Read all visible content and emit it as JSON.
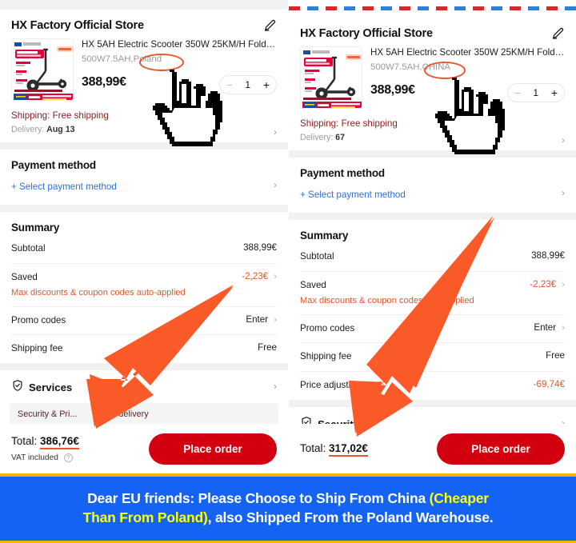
{
  "panels": [
    {
      "id": "left",
      "variant_country": "Poland",
      "store": {
        "name": "HX Factory Official Store",
        "edit_icon": "pencil-icon"
      },
      "product": {
        "title": "HX 5AH Electric Scooter 350W 25KM/H Folda...",
        "variant_prefix": "500W7.5AH,",
        "variant_country": "Poland",
        "price": "388,99€",
        "qty": {
          "minus": "−",
          "value": "1",
          "plus": "+"
        }
      },
      "shipping": {
        "main": "Shipping: Free shipping",
        "delivery_label": "Delivery:",
        "delivery_value": "Aug 13",
        "chevron": "›"
      },
      "payment": {
        "title": "Payment method",
        "select_link": "+ Select payment method",
        "chevron": "›"
      },
      "summary": {
        "title": "Summary",
        "rows": [
          {
            "label": "Subtotal",
            "sub": "",
            "value": "388,99€",
            "value_color": "dark",
            "chevron": ""
          },
          {
            "label": "Saved",
            "sub": "Max discounts & coupon codes auto-applied",
            "value": "-2,23€",
            "value_color": "orange",
            "chevron": "›"
          },
          {
            "label": "Promo codes",
            "sub": "",
            "value": "Enter",
            "value_color": "dark",
            "chevron": "›"
          },
          {
            "label": "Shipping fee",
            "sub": "",
            "value": "Free",
            "value_color": "dark",
            "chevron": ""
          }
        ]
      },
      "services": {
        "title": "Services",
        "shield_icon": "shield-check-icon",
        "chevron": "›",
        "tags": [
          "Security & Pri...",
          "Fast delivery"
        ]
      },
      "footer": {
        "total_label": "Total:",
        "total_amount": "386,76€",
        "vat_text": "VAT included",
        "vat_icon": "?",
        "place_order": "Place order"
      }
    },
    {
      "id": "right",
      "variant_country": "CHINA",
      "store": {
        "name": "HX Factory Official Store",
        "edit_icon": "pencil-icon"
      },
      "product": {
        "title": "HX 5AH Electric Scooter 350W 25KM/H Folda...",
        "variant_prefix": "500W7.5AH,",
        "variant_country": "CHINA",
        "price": "388,99€",
        "qty": {
          "minus": "−",
          "value": "1",
          "plus": "+"
        }
      },
      "shipping": {
        "main": "Shipping: Free shipping",
        "delivery_label": "Delivery:",
        "delivery_value": "67",
        "chevron": "›"
      },
      "payment": {
        "title": "Payment method",
        "select_link": "+ Select payment method",
        "chevron": "›"
      },
      "summary": {
        "title": "Summary",
        "rows": [
          {
            "label": "Subtotal",
            "sub": "",
            "value": "388,99€",
            "value_color": "dark",
            "chevron": ""
          },
          {
            "label": "Saved",
            "sub": "Max discounts & coupon codes auto-applied",
            "value": "-2,23€",
            "value_color": "orange",
            "chevron": "›"
          },
          {
            "label": "Promo codes",
            "sub": "",
            "value": "Enter",
            "value_color": "dark",
            "chevron": "›"
          },
          {
            "label": "Shipping fee",
            "sub": "",
            "value": "Free",
            "value_color": "dark",
            "chevron": ""
          },
          {
            "label": "Price adjustment",
            "sub": "",
            "value": "-69,74€",
            "value_color": "orange",
            "chevron": "",
            "has_info": true
          }
        ]
      },
      "services": {
        "title": "Security &",
        "shield_icon": "shield-check-icon",
        "chevron": "›",
        "tags": []
      },
      "footer": {
        "total_label": "Total:",
        "total_amount": "317,02€",
        "vat_text": "",
        "vat_icon": "",
        "place_order": "Place order"
      }
    }
  ],
  "banner": {
    "line1_a": "Dear EU friends: Please Choose to Ship From China ",
    "line1_hi": "(Cheaper",
    "line2_hi": "Than From Poland)",
    "line2_b": ", also Shipped From the Poland Warehouse."
  },
  "colors": {
    "accent_orange": "#e8552a",
    "place_order_red": "#d3000f",
    "link_blue": "#2f6fe0",
    "banner_blue": "#1463f3",
    "banner_highlight": "#ffff00",
    "banner_border": "#f2b500",
    "shipping_maroon": "#8c2020"
  }
}
